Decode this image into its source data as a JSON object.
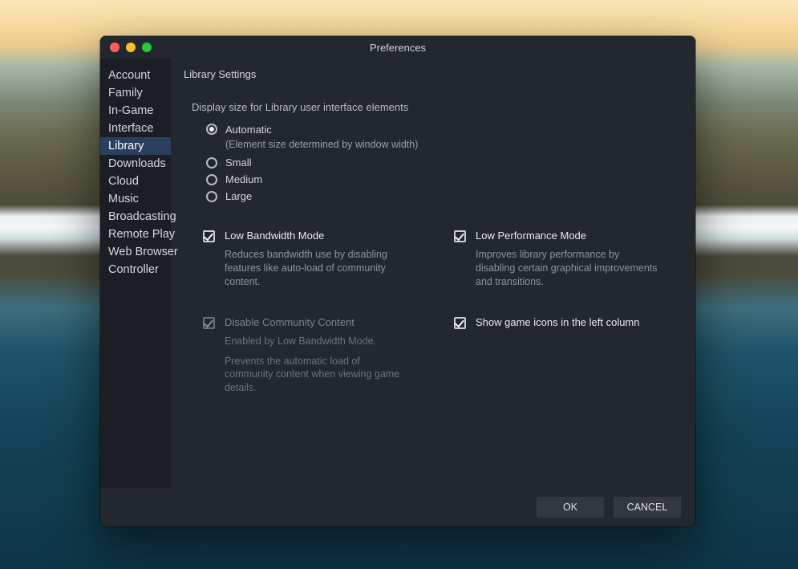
{
  "window": {
    "title": "Preferences"
  },
  "sidebar": {
    "items": [
      {
        "label": "Account"
      },
      {
        "label": "Family"
      },
      {
        "label": "In-Game"
      },
      {
        "label": "Interface"
      },
      {
        "label": "Library",
        "selected": true
      },
      {
        "label": "Downloads"
      },
      {
        "label": "Cloud"
      },
      {
        "label": "Music"
      },
      {
        "label": "Broadcasting"
      },
      {
        "label": "Remote Play"
      },
      {
        "label": "Web Browser"
      },
      {
        "label": "Controller"
      }
    ]
  },
  "main": {
    "section_title": "Library Settings",
    "display_size": {
      "label": "Display size for Library user interface elements",
      "options": [
        {
          "label": "Automatic",
          "sub": "(Element size determined by window width)",
          "checked": true
        },
        {
          "label": "Small",
          "checked": false
        },
        {
          "label": "Medium",
          "checked": false
        },
        {
          "label": "Large",
          "checked": false
        }
      ]
    },
    "low_bandwidth": {
      "label": "Low Bandwidth Mode",
      "desc": "Reduces bandwidth use by disabling features like auto-load of community content.",
      "checked": true
    },
    "low_performance": {
      "label": "Low Performance Mode",
      "desc": "Improves library performance by disabling certain graphical improvements and transitions.",
      "checked": true
    },
    "disable_community": {
      "label": "Disable Community Content",
      "note": "Enabled by Low Bandwidth Mode.",
      "desc": "Prevents the automatic load of community content when viewing game details.",
      "checked": true,
      "disabled": true
    },
    "show_game_icons": {
      "label": "Show game icons in the left column",
      "checked": true
    }
  },
  "footer": {
    "ok": "OK",
    "cancel": "CANCEL"
  }
}
